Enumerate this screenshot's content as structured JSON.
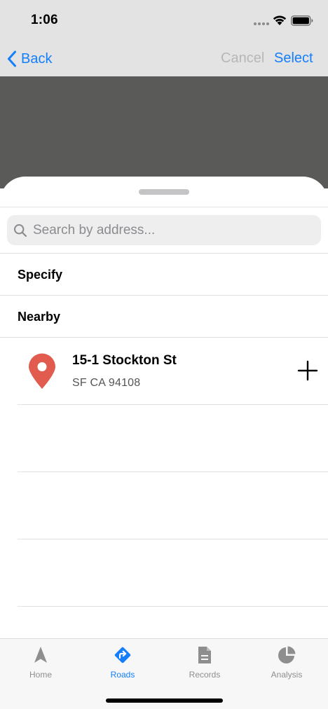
{
  "status_bar": {
    "time": "1:06"
  },
  "nav": {
    "back_label": "Back",
    "cancel_label": "Cancel",
    "select_label": "Select"
  },
  "search": {
    "placeholder": "Search by address...",
    "value": ""
  },
  "sections": {
    "specify": "Specify",
    "nearby": "Nearby"
  },
  "results": [
    {
      "title": "15-1 Stockton St",
      "subtitle": "SF CA 94108",
      "icon": "map-pin-icon",
      "action_icon": "plus-icon"
    }
  ],
  "tabs": [
    {
      "label": "Home",
      "icon": "navigation-arrow-icon",
      "active": false
    },
    {
      "label": "Roads",
      "icon": "directions-icon",
      "active": true
    },
    {
      "label": "Records",
      "icon": "document-icon",
      "active": false
    },
    {
      "label": "Analysis",
      "icon": "pie-chart-icon",
      "active": false
    }
  ],
  "colors": {
    "accent": "#147efb",
    "pin": "#e15b4f",
    "inactive_tab": "#8e8e8e",
    "disabled_text": "#b7b7b7"
  }
}
